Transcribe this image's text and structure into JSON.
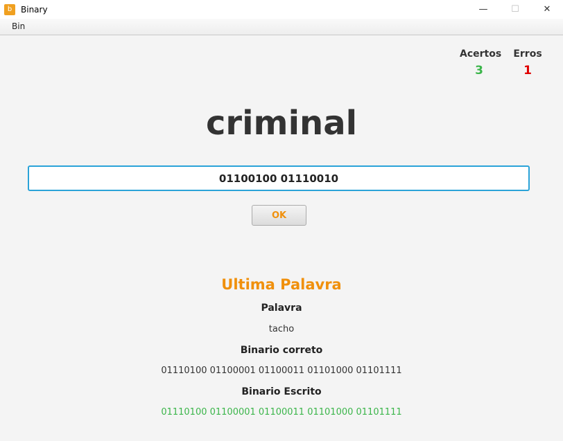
{
  "window": {
    "title": "Binary",
    "app_icon_glyph": "b"
  },
  "menu": {
    "items": [
      "Bin"
    ]
  },
  "score": {
    "acertos_label": "Acertos",
    "acertos_value": "3",
    "erros_label": "Erros",
    "erros_value": "1",
    "colors": {
      "acertos": "#3bb54a",
      "erros": "#e00000"
    }
  },
  "current": {
    "word": "criminal",
    "input_value": "01100100 01110010",
    "ok_label": "OK"
  },
  "last": {
    "title": "Ultima Palavra",
    "palavra_label": "Palavra",
    "palavra_value": "tacho",
    "correct_label": "Binario correto",
    "correct_value": "01110100 01100001 01100011 01101000 01101111",
    "written_label": "Binario Escrito",
    "written_value": "01110100 01100001 01100011 01101000 01101111"
  },
  "accent_color": "#f0900c"
}
